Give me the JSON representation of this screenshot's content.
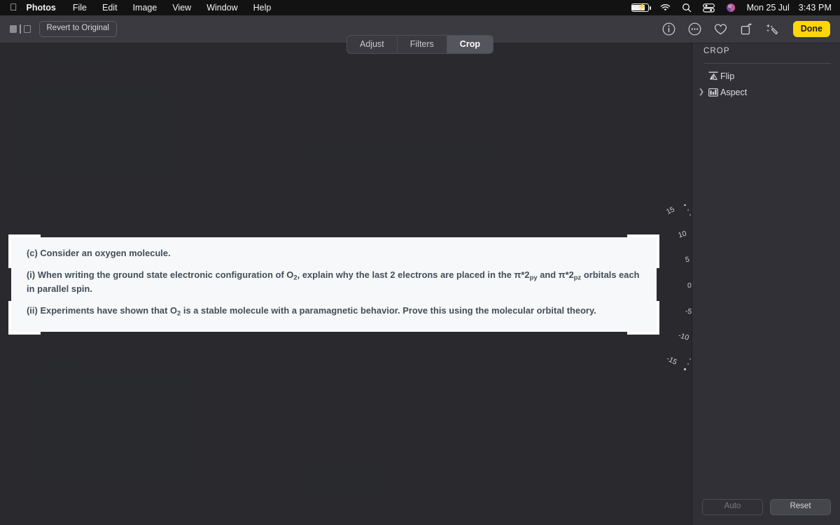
{
  "menubar": {
    "apple_logo": "",
    "items": [
      {
        "label": "Photos",
        "bold": true
      },
      {
        "label": "File"
      },
      {
        "label": "Edit"
      },
      {
        "label": "Image"
      },
      {
        "label": "View"
      },
      {
        "label": "Window"
      },
      {
        "label": "Help"
      }
    ],
    "status": {
      "battery_icon": "battery-charging-icon",
      "wifi_icon": "wifi-icon",
      "search_icon": "search-icon",
      "control_center_icon": "control-center-icon",
      "siri_icon": "siri-icon",
      "date": "Mon 25 Jul",
      "time": "3:43 PM"
    }
  },
  "toolbar": {
    "compare_toggle_icon": "compare-toggle-icon",
    "revert_label": "Revert to Original",
    "segments": [
      {
        "label": "Adjust",
        "active": false
      },
      {
        "label": "Filters",
        "active": false
      },
      {
        "label": "Crop",
        "active": true
      }
    ],
    "icons": [
      {
        "name": "info-icon"
      },
      {
        "name": "more-options-icon"
      },
      {
        "name": "favorite-heart-icon"
      },
      {
        "name": "rotate-icon"
      },
      {
        "name": "auto-enhance-icon"
      }
    ],
    "done_label": "Done"
  },
  "sidebar": {
    "title": "CROP",
    "items": [
      {
        "label": "Flip",
        "icon": "flip-icon",
        "chevron": false
      },
      {
        "label": "Aspect",
        "icon": "aspect-icon",
        "chevron": true
      }
    ],
    "auto_label": "Auto",
    "reset_label": "Reset"
  },
  "dial": {
    "labels": [
      "15",
      "10",
      "5",
      "0",
      "-5",
      "-10",
      "-15"
    ],
    "value": "0",
    "accent_color": "#3f8cff"
  },
  "document": {
    "paragraphs": [
      {
        "id": "part-c",
        "runs": [
          {
            "t": "(c) Consider an oxygen molecule."
          }
        ]
      },
      {
        "id": "part-i",
        "runs": [
          {
            "t": "(i)  When writing the ground state electronic configuration of O"
          },
          {
            "t": "2",
            "sub": true
          },
          {
            "t": ", explain why the last 2 electrons are placed in the π*2"
          },
          {
            "t": "py",
            "sub": true
          },
          {
            "t": " and π*2"
          },
          {
            "t": "pz",
            "sub": true
          },
          {
            "t": " orbitals each in parallel spin."
          }
        ]
      },
      {
        "id": "part-ii",
        "runs": [
          {
            "t": "(ii)  Experiments have shown that O"
          },
          {
            "t": "2",
            "sub": true
          },
          {
            "t": " is a stable molecule with a paramagnetic behavior. Prove this using the molecular orbital theory."
          }
        ]
      }
    ]
  }
}
